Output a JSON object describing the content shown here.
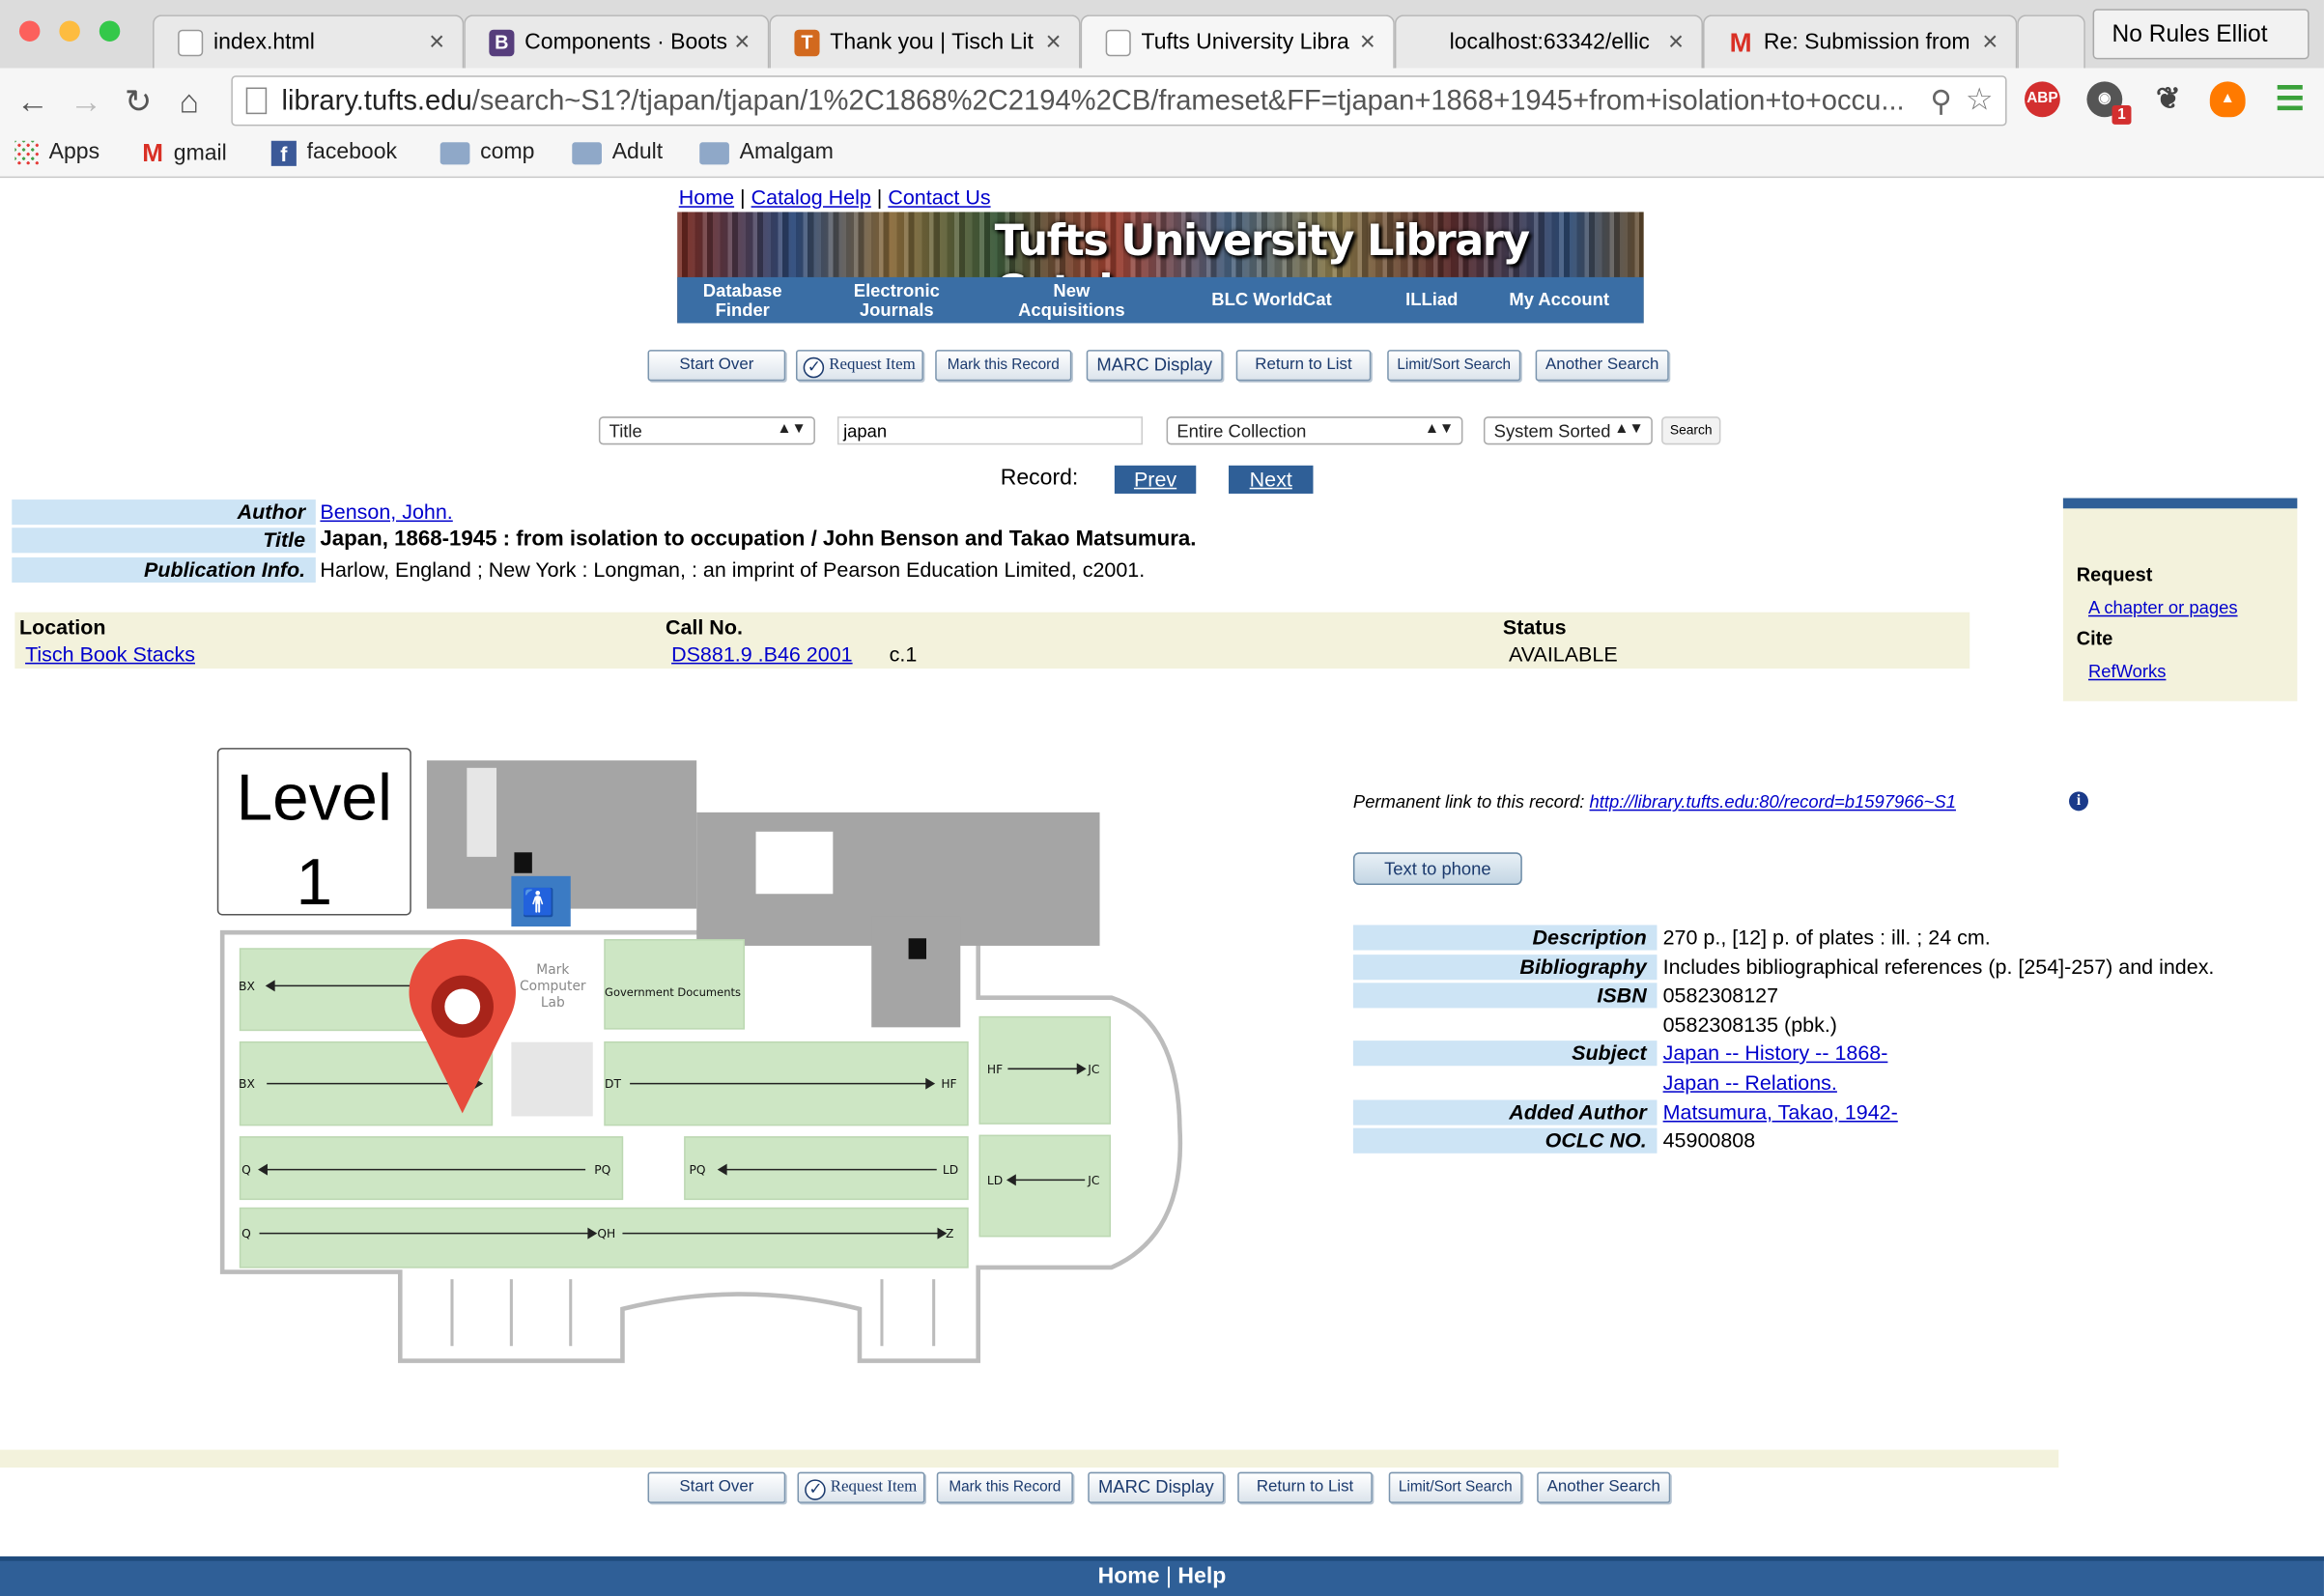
{
  "browser": {
    "tabs": [
      {
        "title": "index.html",
        "icon": "page-icon",
        "active": false
      },
      {
        "title": "Components · Boots",
        "icon": "bootstrap-icon",
        "active": false
      },
      {
        "title": "Thank you | Tisch Lit",
        "icon": "tisch-icon",
        "active": false
      },
      {
        "title": "Tufts University Libra",
        "icon": "page-icon",
        "active": true
      },
      {
        "title": "localhost:63342/ellic",
        "icon": "none",
        "active": false
      },
      {
        "title": "Re: Submission from",
        "icon": "gmail-icon",
        "active": false
      }
    ],
    "profile_name": "No Rules Elliot",
    "url_host": "library.tufts.edu",
    "url_path": "/search~S1?/tjapan/tjapan/1%2C1868%2C2194%2CB/frameset&FF=tjapan+1868+1945+from+isolation+to+occu...",
    "extensions": {
      "adblock": "ABP",
      "badge_count": "1"
    },
    "bookmarks": [
      "Apps",
      "gmail",
      "facebook",
      "comp",
      "Adult",
      "Amalgam"
    ]
  },
  "page": {
    "top_links": [
      "Home",
      "Catalog Help",
      "Contact Us"
    ],
    "banner": {
      "title": "Tufts University Library Catalog",
      "menu": [
        "Database Finder",
        "Electronic Journals",
        "New Acquisitions",
        "BLC WorldCat",
        "ILLiad",
        "My Account"
      ]
    },
    "action_buttons": [
      "Start Over",
      "Request Item",
      "Mark this Record",
      "MARC Display",
      "Return to List",
      "Limit/Sort Search",
      "Another Search"
    ],
    "search": {
      "field": "Title",
      "query": "japan",
      "scope": "Entire Collection",
      "sort": "System Sorted",
      "button": "Search"
    },
    "record_nav": {
      "label": "Record:",
      "prev": "Prev",
      "next": "Next"
    },
    "bib": {
      "author_label": "Author",
      "author": "Benson, John.",
      "title_label": "Title",
      "title": "Japan, 1868-1945 : from isolation to occupation / John Benson and Takao Matsumura.",
      "pub_label": "Publication Info.",
      "pub": "Harlow, England ; New York : Longman, : an imprint of Pearson Education Limited, c2001."
    },
    "holdings": {
      "headers": [
        "Location",
        "Call No.",
        "Status"
      ],
      "location": "Tisch Book Stacks",
      "call_no": "DS881.9 .B46 2001",
      "copy": "c.1",
      "status": "AVAILABLE"
    },
    "sidebar": {
      "request_heading": "Request",
      "request_link": "A chapter or pages",
      "cite_heading": "Cite",
      "cite_link": "RefWorks"
    },
    "map": {
      "level_line1": "Level",
      "level_line2": "1",
      "lab_label1": "Mark",
      "lab_label2": "Computer",
      "lab_label3": "Lab",
      "gov_docs": "Government Documents",
      "stack_labels": [
        "BX",
        "BX",
        "DT",
        "HF",
        "HF",
        "JC",
        "Q",
        "PQ",
        "PQ",
        "LD",
        "LD",
        "JC",
        "Q",
        "QH",
        "Z"
      ]
    },
    "permalink": {
      "label": "Permanent link to this record:",
      "url": "http://library.tufts.edu:80/record=b1597966~S1"
    },
    "text_to_phone": "Text to phone",
    "details": {
      "description_label": "Description",
      "description": "270 p., [12] p. of plates : ill. ; 24 cm.",
      "bibliography_label": "Bibliography",
      "bibliography": "Includes bibliographical references (p. [254]-257) and index.",
      "isbn_label": "ISBN",
      "isbn1": "0582308127",
      "isbn2": "0582308135 (pbk.)",
      "subject_label": "Subject",
      "subject1": "Japan -- History -- 1868-",
      "subject2": "Japan -- Relations.",
      "added_author_label": "Added Author",
      "added_author": "Matsumura, Takao, 1942-",
      "oclc_label": "OCLC NO.",
      "oclc": "45900808"
    },
    "footer": {
      "home": "Home",
      "help": "Help"
    }
  }
}
